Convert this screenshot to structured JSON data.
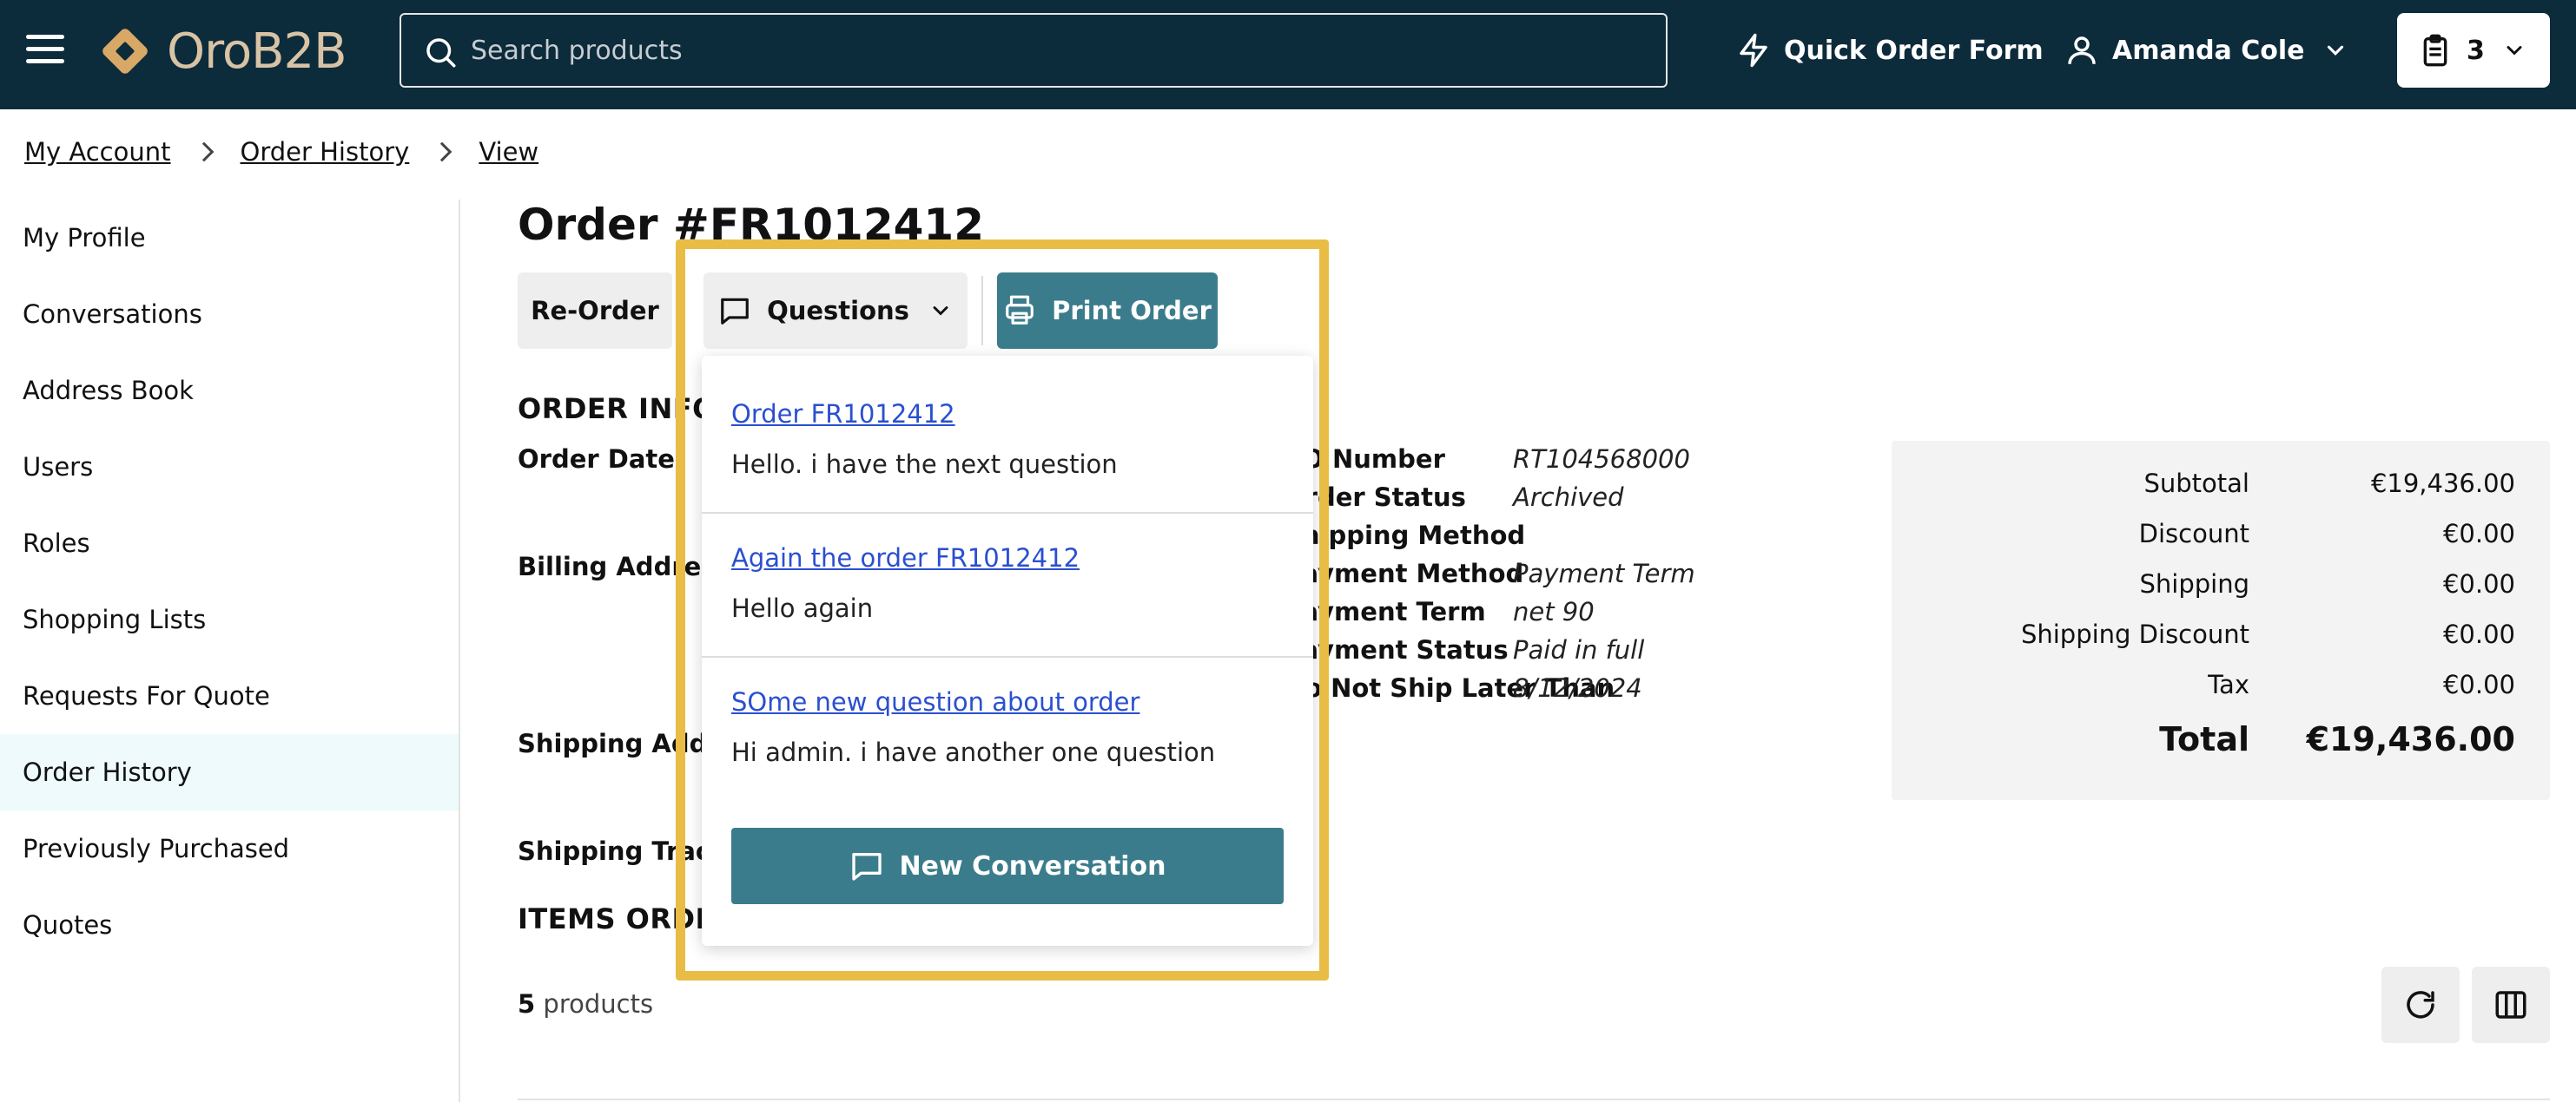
{
  "header": {
    "logo_text": "OroB2B",
    "search_placeholder": "Search products",
    "quick_order_label": "Quick Order Form",
    "user_name": "Amanda Cole",
    "cart_count": "3",
    "colors": {
      "header_bg": "#0c2b3b",
      "accent_teal": "#3b7c8c",
      "highlight": "#e9bd45",
      "link": "#2a4fd1"
    }
  },
  "breadcrumb": [
    "My Account",
    "Order History",
    "View"
  ],
  "sidebar": {
    "items": [
      {
        "label": "My Profile"
      },
      {
        "label": "Conversations"
      },
      {
        "label": "Address Book"
      },
      {
        "label": "Users"
      },
      {
        "label": "Roles"
      },
      {
        "label": "Shopping Lists"
      },
      {
        "label": "Requests For Quote"
      },
      {
        "label": "Order History",
        "active": true
      },
      {
        "label": "Previously Purchased"
      },
      {
        "label": "Quotes"
      }
    ]
  },
  "order": {
    "title": "Order #FR1012412",
    "reorder_label": "Re-Order",
    "questions_label": "Questions",
    "print_label": "Print Order",
    "section_info": "ORDER INFORMATION",
    "section_items": "ITEMS ORDERED",
    "labels": {
      "order_date": "Order Date",
      "billing_address": "Billing Address",
      "shipping_address": "Shipping Address",
      "shipping_tracking": "Shipping Tracking"
    },
    "info_rows": [
      {
        "label": "PO Number",
        "value": "RT104568000"
      },
      {
        "label": "Order Status",
        "value": "Archived"
      },
      {
        "label": "Shipping Method",
        "value": ""
      },
      {
        "label": "Payment Method",
        "value": "Payment Term"
      },
      {
        "label": "Payment Term",
        "value": "net 90"
      },
      {
        "label": "Payment Status",
        "value": "Paid in full"
      },
      {
        "label": "Do Not Ship Later Than",
        "value": "8/12/2024"
      }
    ],
    "products_count": "5",
    "products_word": "products"
  },
  "summary": {
    "rows": [
      {
        "label": "Subtotal",
        "value": "€19,436.00"
      },
      {
        "label": "Discount",
        "value": "€0.00"
      },
      {
        "label": "Shipping",
        "value": "€0.00"
      },
      {
        "label": "Shipping Discount",
        "value": "€0.00"
      },
      {
        "label": "Tax",
        "value": "€0.00"
      }
    ],
    "total_label": "Total",
    "total_value": "€19,436.00"
  },
  "questions_dropdown": {
    "items": [
      {
        "title": "Order FR1012412",
        "message": "Hello. i have the next question"
      },
      {
        "title": "Again the order FR1012412",
        "message": "Hello again"
      },
      {
        "title": "SOme new question about order",
        "message": "Hi admin. i have another one question"
      }
    ],
    "new_conversation_label": "New Conversation"
  }
}
